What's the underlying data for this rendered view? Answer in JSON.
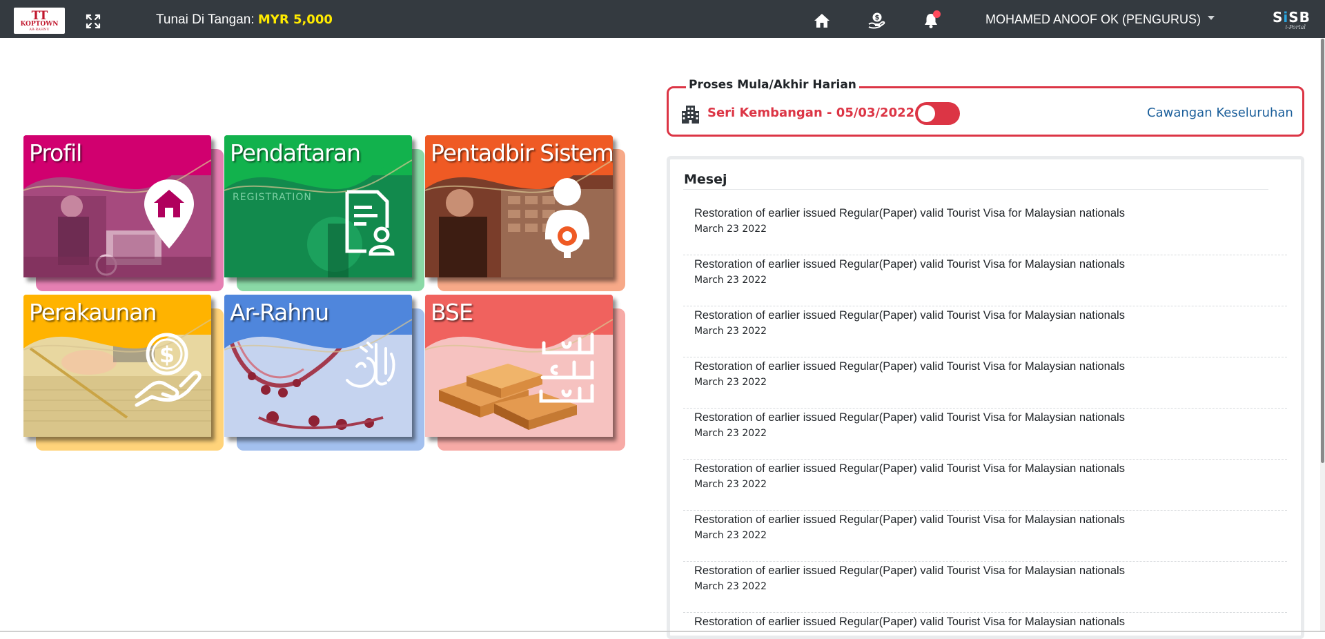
{
  "header": {
    "logo_mark": "TT",
    "logo_name": "KOPTOWN",
    "logo_sub": "AR-RAHNU",
    "cash_label": "Tunai Di Tangan: ",
    "cash_amount": "MYR 5,000",
    "user_label": "MOHAMED ANOOF OK (PENGURUS)",
    "brand_main_s1": "S",
    "brand_main_i": "i",
    "brand_main_sb": "SB",
    "brand_sub": "i-Portal",
    "icons": [
      "expand-icon",
      "home-icon",
      "money-hand-icon",
      "bell-icon",
      "caret-down-icon"
    ]
  },
  "tiles": [
    {
      "title": "Profil",
      "color": "#d1006f",
      "back": "#e57fb2",
      "icon": "home-pin-icon"
    },
    {
      "title": "Pendaftaran",
      "color": "#12b24d",
      "back": "#8ad9a6",
      "icon": "registration-form-icon",
      "watermark": "REGISTRATION"
    },
    {
      "title": "Pentadbir Sistem",
      "color": "#ef5a24",
      "back": "#f7a988",
      "icon": "user-gear-icon"
    },
    {
      "title": "Perakaunan",
      "color": "#ffb300",
      "back": "#ffd37a",
      "icon": "dollar-hand-icon"
    },
    {
      "title": "Ar-Rahnu",
      "color": "#4f86dc",
      "back": "#a3c0ee",
      "icon": "arabic-calligraphy-icon"
    },
    {
      "title": "BSE",
      "color": "#f0625e",
      "back": "#f7aaa6",
      "icon": "arabic-calligraphy-icon"
    }
  ],
  "proses": {
    "legend": "Proses Mula/Akhir Harian",
    "branch_name": "Seri Kembangan",
    "branch_sep": " - ",
    "branch_date": "05/03/2022",
    "link": "Cawangan Keseluruhan",
    "toggle_on": true,
    "accent": "#dc3545"
  },
  "mesej": {
    "title": "Mesej",
    "items": [
      {
        "text": "Restoration of earlier issued Regular(Paper) valid Tourist Visa for Malaysian nationals",
        "date": "March 23 2022"
      },
      {
        "text": "Restoration of earlier issued Regular(Paper) valid Tourist Visa for Malaysian nationals",
        "date": "March 23 2022"
      },
      {
        "text": "Restoration of earlier issued Regular(Paper) valid Tourist Visa for Malaysian nationals",
        "date": "March 23 2022"
      },
      {
        "text": "Restoration of earlier issued Regular(Paper) valid Tourist Visa for Malaysian nationals",
        "date": "March 23 2022"
      },
      {
        "text": "Restoration of earlier issued Regular(Paper) valid Tourist Visa for Malaysian nationals",
        "date": "March 23 2022"
      },
      {
        "text": "Restoration of earlier issued Regular(Paper) valid Tourist Visa for Malaysian nationals",
        "date": "March 23 2022"
      },
      {
        "text": "Restoration of earlier issued Regular(Paper) valid Tourist Visa for Malaysian nationals",
        "date": "March 23 2022"
      },
      {
        "text": "Restoration of earlier issued Regular(Paper) valid Tourist Visa for Malaysian nationals",
        "date": "March 23 2022"
      },
      {
        "text": "Restoration of earlier issued Regular(Paper) valid Tourist Visa for Malaysian nationals",
        "date": ""
      }
    ]
  }
}
